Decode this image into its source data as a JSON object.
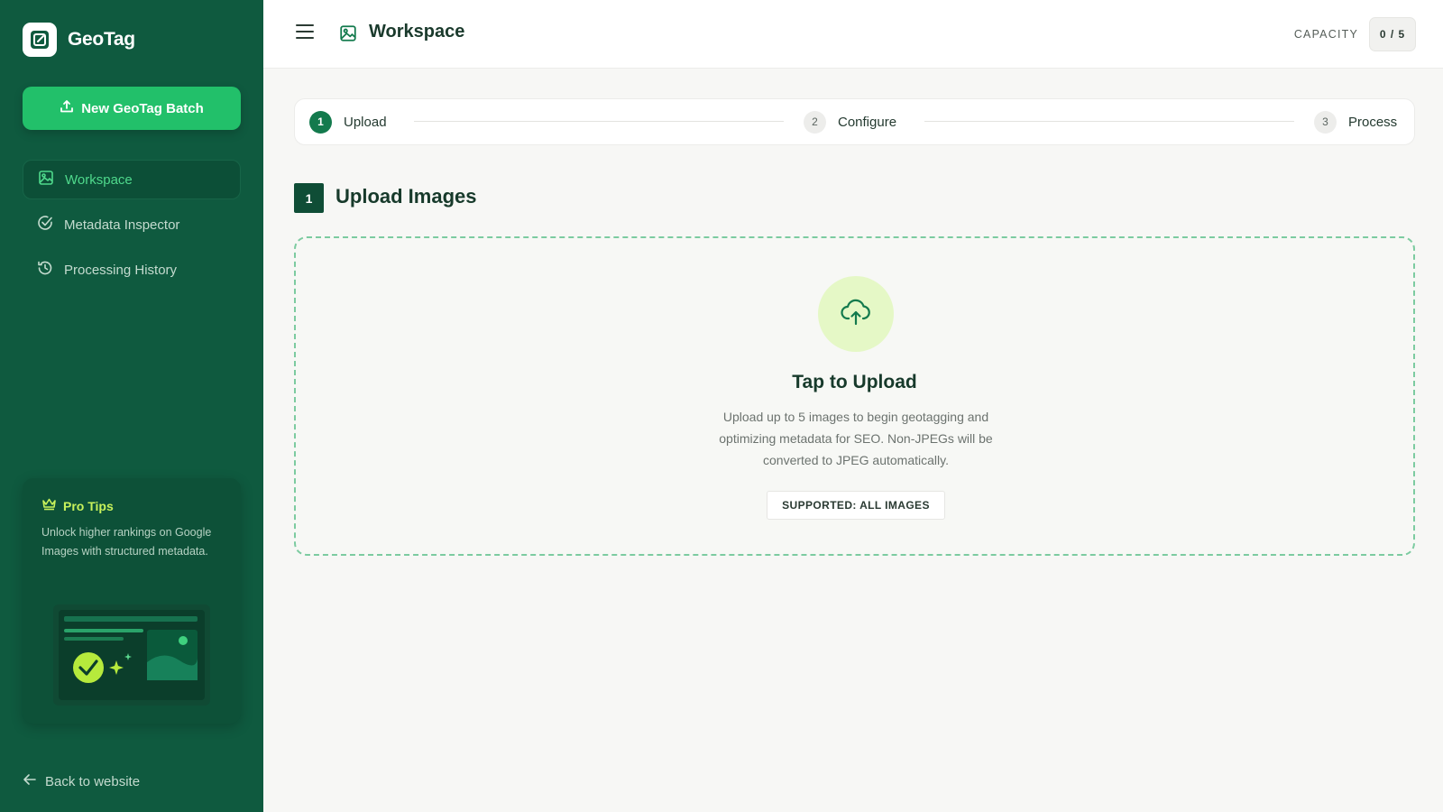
{
  "sidebar": {
    "brand": "GeoTag",
    "new_batch_label": "New GeoTag Batch",
    "nav": [
      {
        "label": "Workspace",
        "icon": "image-icon",
        "active": true
      },
      {
        "label": "Metadata Inspector",
        "icon": "check-circle-icon",
        "active": false
      },
      {
        "label": "Processing History",
        "icon": "history-icon",
        "active": false
      }
    ],
    "pro_tips": {
      "title": "Pro Tips",
      "text": "Unlock higher rankings on Google Images with structured metadata."
    },
    "back_label": "Back to website"
  },
  "header": {
    "title": "Workspace",
    "capacity_label": "CAPACITY",
    "capacity_value": "0 / 5"
  },
  "stepper": {
    "steps": [
      {
        "number": "1",
        "label": "Upload",
        "active": true
      },
      {
        "number": "2",
        "label": "Configure",
        "active": false
      },
      {
        "number": "3",
        "label": "Process",
        "active": false
      }
    ]
  },
  "section": {
    "number": "1",
    "title": "Upload Images"
  },
  "dropzone": {
    "title": "Tap to Upload",
    "description": "Upload up to 5 images to begin geotagging and optimizing metadata for SEO. Non-JPEGs will be converted to JPEG automatically.",
    "badge": "SUPPORTED: ALL IMAGES"
  },
  "colors": {
    "sidebar_bg": "#0f5a3f",
    "accent": "#22c06a",
    "step_active": "#137a4d",
    "pro_tips_title": "#c8f25b"
  }
}
